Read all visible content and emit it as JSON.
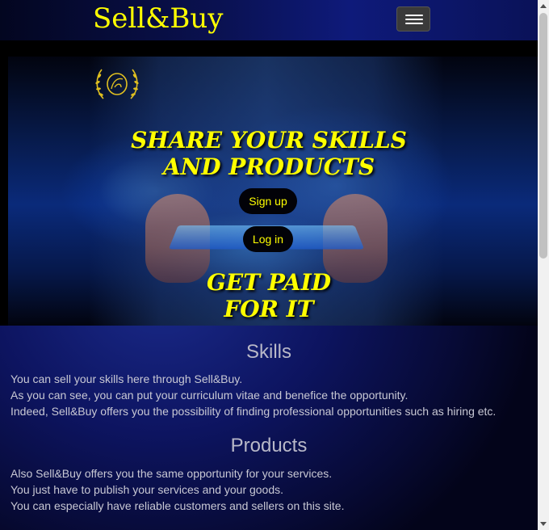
{
  "navbar": {
    "brand": "Sell&Buy",
    "menu_toggle_icon": "hamburger-menu-icon"
  },
  "hero": {
    "logo_icon": "laurel-crest-logo",
    "title_1": "SHARE YOUR SKILLS AND PRODUCTS",
    "signup_label": "Sign up",
    "login_label": "Log in",
    "title_2": "GET PAID FOR IT"
  },
  "skills": {
    "title": "Skills",
    "lines": [
      "You can sell your skills here through Sell&Buy.",
      "As you can see, you can put your curriculum vitae and benefice the opportunity.",
      "Indeed, Sell&Buy offers you the possibility of finding professional opportunities such as hiring etc."
    ]
  },
  "products": {
    "title": "Products",
    "lines": [
      "Also Sell&Buy offers you the same opportunity for your services.",
      "You just have to publish your services and your goods.",
      "You can especially have reliable customers and sellers on this site."
    ]
  },
  "colors": {
    "accent_yellow": "#ffff00",
    "navy_background": "#0d1460",
    "button_background": "#020208"
  }
}
